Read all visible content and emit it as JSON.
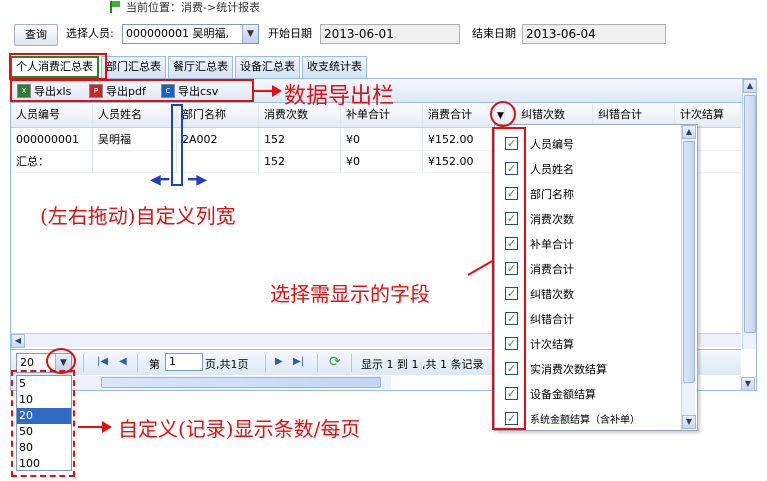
{
  "breadcrumb": "当前位置：消费->统计报表",
  "query": {
    "button": "查询",
    "person_label": "选择人员:",
    "person_value": "000000001 吴明福,",
    "start_label": "开始日期",
    "start_value": "2013-06-01",
    "end_label": "结束日期",
    "end_value": "2013-06-04"
  },
  "tabs": [
    "个人消费汇总表",
    "部门汇总表",
    "餐厅汇总表",
    "设备汇总表",
    "收支统计表"
  ],
  "toolbar": {
    "xls": "导出xls",
    "pdf": "导出pdf",
    "csv": "导出csv"
  },
  "table": {
    "headers": [
      "人员编号",
      "人员姓名",
      "部门名称",
      "消费次数",
      "补单合计",
      "消费合计",
      "纠错次数",
      "纠错合计",
      "计次结算"
    ],
    "rows": [
      [
        "000000001",
        "吴明福",
        "2A002",
        "152",
        "¥0",
        "¥152.00"
      ],
      [
        "汇总：",
        "",
        "",
        "152",
        "¥0",
        "¥152.00"
      ]
    ]
  },
  "column_menu": [
    "人员编号",
    "人员姓名",
    "部门名称",
    "消费次数",
    "补单合计",
    "消费合计",
    "纠错次数",
    "纠错合计",
    "计次结算",
    "实消费次数结算",
    "设备金额结算",
    "系统金额结算（含补单）"
  ],
  "pager": {
    "page_size": "20",
    "page_prefix": "第",
    "page_number": "1",
    "page_suffix": "页,共1页",
    "info": "显示 1 到 1 ,共 1 条记录",
    "size_options": [
      "5",
      "10",
      "20",
      "50",
      "80",
      "100"
    ]
  },
  "annotations": {
    "export_bar": "数据导出栏",
    "column_width": "(左右拖动)自定义列宽",
    "choose_fields": "选择需显示的字段",
    "page_size": "自定义(记录)显示条数/每页"
  },
  "colors": {
    "annotation": "#e01010",
    "active_tab_border": "#1a8a2a",
    "selected_option": "#316ac5"
  }
}
